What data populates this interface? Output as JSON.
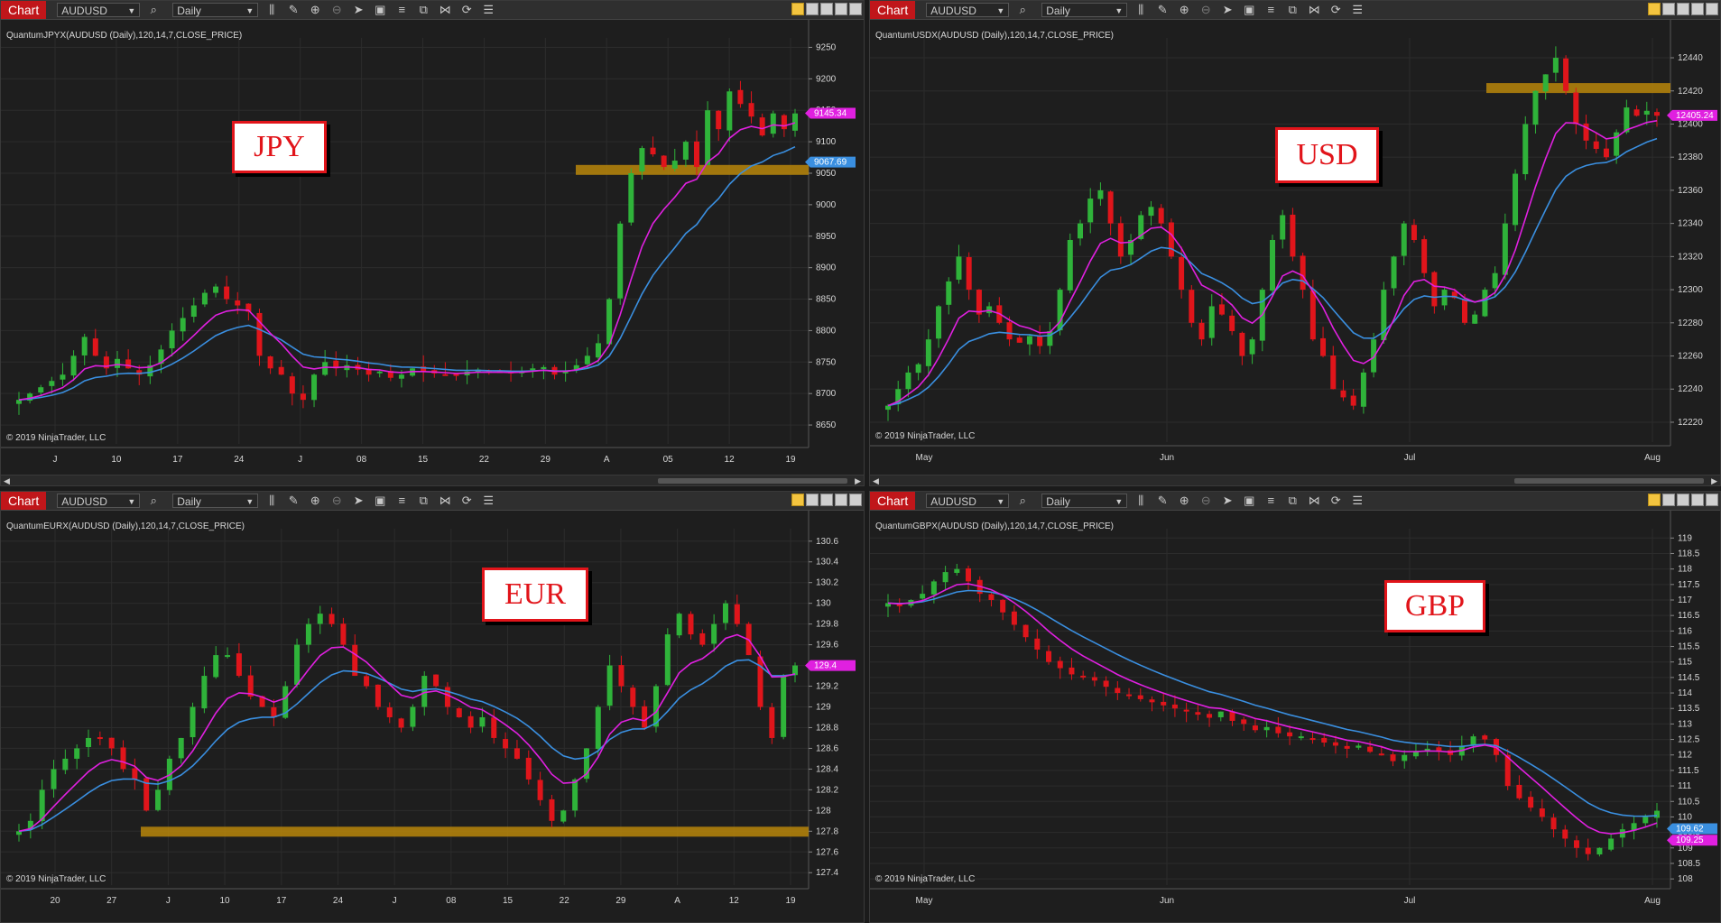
{
  "panels": [
    {
      "id": "jpy",
      "toolbar": {
        "tab": "Chart",
        "instrument": "AUDUSD",
        "interval": "Daily"
      },
      "indicator_label": "QuantumJPYX(AUDUSD (Daily),120,14,7,CLOSE_PRICE)",
      "copyright": "© 2019 NinjaTrader, LLC",
      "callout": "JPY",
      "y_ticks": [
        "9250",
        "9200",
        "9150",
        "9100",
        "9050",
        "9000",
        "8950",
        "8900",
        "8850",
        "8800",
        "8750",
        "8700",
        "8650"
      ],
      "x_ticks": [
        "J",
        "10",
        "17",
        "24",
        "J",
        "08",
        "15",
        "22",
        "29",
        "A",
        "05",
        "12",
        "19"
      ],
      "price_tags": [
        {
          "value": "9145.34",
          "color": "#e020e0"
        },
        {
          "value": "9067.69",
          "color": "#3a8fe0"
        }
      ]
    },
    {
      "id": "usd",
      "toolbar": {
        "tab": "Chart",
        "instrument": "AUDUSD",
        "interval": "Daily"
      },
      "indicator_label": "QuantumUSDX(AUDUSD (Daily),120,14,7,CLOSE_PRICE)",
      "copyright": "© 2019 NinjaTrader, LLC",
      "callout": "USD",
      "y_ticks": [
        "12440",
        "12420",
        "12400",
        "12380",
        "12360",
        "12340",
        "12320",
        "12300",
        "12280",
        "12260",
        "12240",
        "12220"
      ],
      "x_ticks": [
        "May",
        "Jun",
        "Jul",
        "Aug"
      ],
      "price_tags": [
        {
          "value": "12405.24",
          "color": "#e020e0"
        }
      ]
    },
    {
      "id": "eur",
      "toolbar": {
        "tab": "Chart",
        "instrument": "AUDUSD",
        "interval": "Daily"
      },
      "indicator_label": "QuantumEURX(AUDUSD (Daily),120,14,7,CLOSE_PRICE)",
      "copyright": "© 2019 NinjaTrader, LLC",
      "callout": "EUR",
      "y_ticks": [
        "130.6",
        "130.4",
        "130.2",
        "130",
        "129.8",
        "129.6",
        "129.4",
        "129.2",
        "129",
        "128.8",
        "128.6",
        "128.4",
        "128.2",
        "128",
        "127.8",
        "127.6",
        "127.4"
      ],
      "x_ticks": [
        "20",
        "27",
        "J",
        "10",
        "17",
        "24",
        "J",
        "08",
        "15",
        "22",
        "29",
        "A",
        "12",
        "19"
      ],
      "price_tags": [
        {
          "value": "129.4",
          "color": "#e020e0"
        }
      ]
    },
    {
      "id": "gbp",
      "toolbar": {
        "tab": "Chart",
        "instrument": "AUDUSD",
        "interval": "Daily"
      },
      "indicator_label": "QuantumGBPX(AUDUSD (Daily),120,14,7,CLOSE_PRICE)",
      "copyright": "© 2019 NinjaTrader, LLC",
      "callout": "GBP",
      "y_ticks": [
        "119",
        "118.5",
        "118",
        "117.5",
        "117",
        "116.5",
        "116",
        "115.5",
        "115",
        "114.5",
        "114",
        "113.5",
        "113",
        "112.5",
        "112",
        "111.5",
        "111",
        "110.5",
        "110",
        "109.5",
        "109",
        "108.5",
        "108"
      ],
      "x_ticks": [
        "May",
        "Jun",
        "Jul",
        "Aug"
      ],
      "price_tags": [
        {
          "value": "109.62",
          "color": "#3a8fe0"
        },
        {
          "value": "109.25",
          "color": "#e020e0"
        }
      ]
    }
  ],
  "colors": {
    "up": "#2fb33a",
    "down": "#e0151b",
    "fast_ma": "#e020e0",
    "slow_ma": "#3a8fe0",
    "zone": "#b8860b"
  },
  "icons": [
    "bar-type-icon",
    "pencil-icon",
    "zoom-in-icon",
    "zoom-out-icon",
    "pointer-icon",
    "data-box-icon",
    "bars-icon",
    "stack-icon",
    "strategy-icon",
    "refresh-icon",
    "properties-icon"
  ]
}
